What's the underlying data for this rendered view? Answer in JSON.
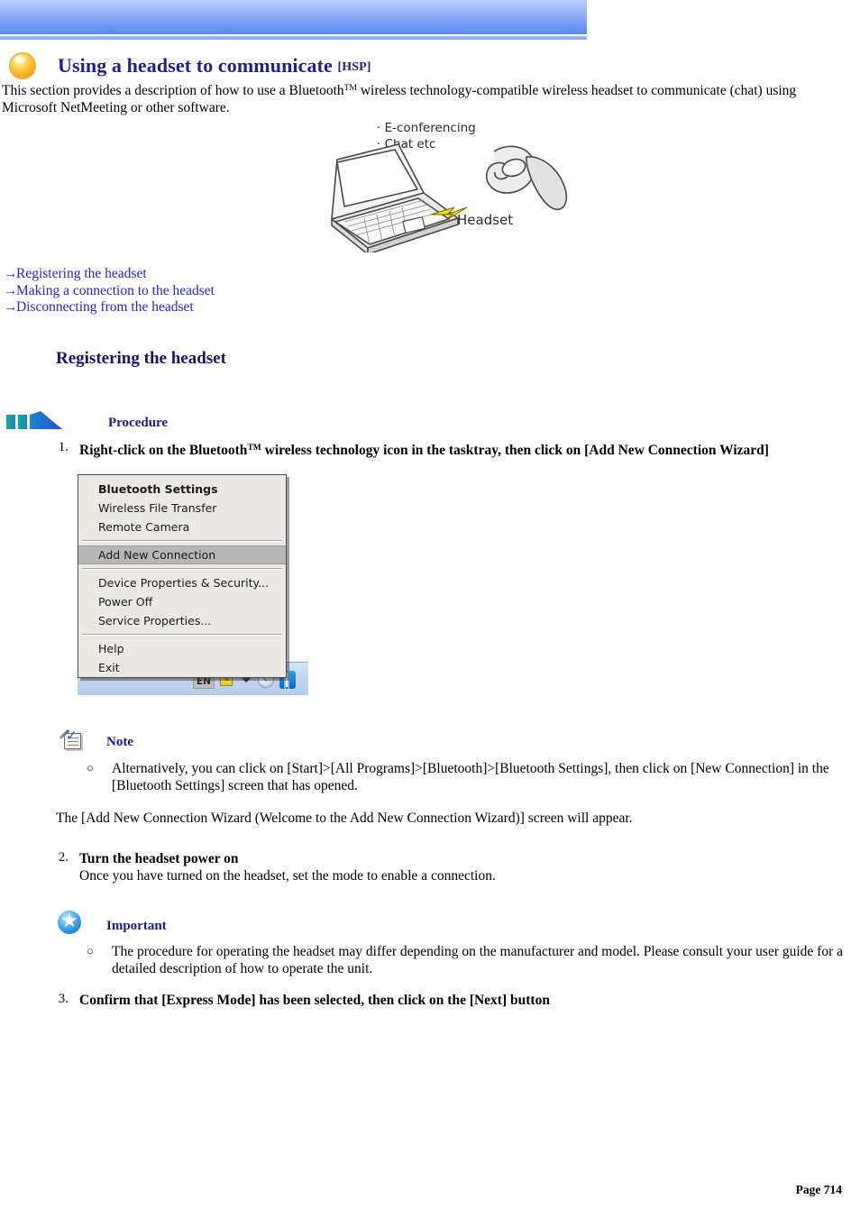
{
  "banner": {
    "gradient_top": "#bdd0fb",
    "gradient_bottom": "#5f8bf2"
  },
  "header": {
    "icon": "gold-orb-icon",
    "title": "Using a headset to communicate ",
    "title_suffix": "[HSP]",
    "title_color": "#1f1f8f",
    "intro_part1": "This section provides a description of how to use a Bluetooth",
    "intro_tm": "TM",
    "intro_part2": " wireless technology-compatible wireless headset to communicate (chat) using Microsoft NetMeeting or other software."
  },
  "illustration": {
    "caption_line1": "· E-conferencing",
    "caption_line2": "· Chat etc",
    "headset_label": "Headset"
  },
  "links": [
    {
      "arrow": "→",
      "label": "Registering the headset"
    },
    {
      "arrow": "→",
      "label": "Making a connection to the headset"
    },
    {
      "arrow": "→",
      "label": "Disconnecting from the headset"
    }
  ],
  "section": {
    "heading": "Registering the headset"
  },
  "procedure": {
    "icon": "procedure-arrow-icon",
    "label": "Procedure"
  },
  "steps": [
    {
      "number": "1.",
      "text_bold_a": "Right-click on the Bluetooth",
      "tm": "TM",
      "text_bold_b": " wireless technology icon in the tasktray, then click on [Add New Connection Wizard]"
    },
    {
      "number": "2.",
      "title": "Turn the headset power on",
      "detail": "Once you have turned on the headset, set the mode to enable a connection."
    },
    {
      "number": "3.",
      "title": "Confirm that [Express Mode] has been selected, then click on the [Next] button"
    }
  ],
  "context_menu": {
    "items": [
      {
        "label": "Bluetooth Settings",
        "bold": true,
        "selected": false
      },
      {
        "label": "Wireless File Transfer",
        "bold": false,
        "selected": false
      },
      {
        "label": "Remote Camera",
        "bold": false,
        "selected": false
      },
      {
        "label": "Add New Connection",
        "bold": false,
        "selected": true
      },
      {
        "label": "Device Properties & Security...",
        "bold": false,
        "selected": false
      },
      {
        "label": "Power Off",
        "bold": false,
        "selected": false
      },
      {
        "label": "Service Properties...",
        "bold": false,
        "selected": false
      },
      {
        "label": "Help",
        "bold": false,
        "selected": false
      },
      {
        "label": "Exit",
        "bold": false,
        "selected": false
      }
    ],
    "tray": {
      "language": "EN",
      "yellow_icon": "notepad-tray-icon",
      "expand_arrow": "chevron-down-icon",
      "hide_icon": "show-hidden-icons-icon",
      "bluetooth_icon": "bluetooth-tray-icon"
    }
  },
  "note": {
    "icon": "note-document-pencil-icon",
    "label": "Note",
    "bullet_marker": "○",
    "bullet_text": "Alternatively, you can click on [Start]>[All Programs]>[Bluetooth]>[Bluetooth Settings], then click on [New Connection] in the [Bluetooth Settings] screen that has opened.",
    "after_text": "The [Add New Connection Wizard (Welcome to the Add New Connection Wizard)] screen will appear."
  },
  "important": {
    "icon": "important-star-icon",
    "label": "Important",
    "bullet_marker": "○",
    "bullet_text": "The procedure for operating the headset may differ depending on the manufacturer and model. Please consult your user guide for a detailed description of how to operate the unit."
  },
  "footer": {
    "page_label": "Page 714"
  }
}
